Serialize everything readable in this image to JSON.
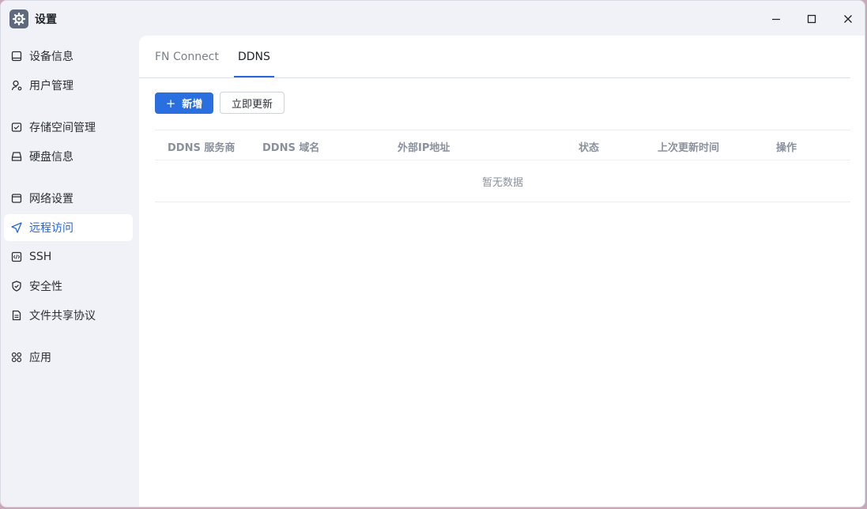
{
  "window": {
    "title": "设置",
    "app_icon": "gear-icon",
    "controls": [
      "minimize-icon",
      "maximize-icon",
      "close-icon"
    ]
  },
  "sidebar": {
    "items": [
      {
        "label": "设备信息",
        "icon": "device-icon"
      },
      {
        "label": "用户管理",
        "icon": "user-icon"
      },
      {
        "label": "存储空间管理",
        "icon": "storage-icon"
      },
      {
        "label": "硬盘信息",
        "icon": "disk-icon"
      },
      {
        "label": "网络设置",
        "icon": "network-icon"
      },
      {
        "label": "远程访问",
        "icon": "send-icon",
        "active": true
      },
      {
        "label": "SSH",
        "icon": "code-icon"
      },
      {
        "label": "安全性",
        "icon": "shield-icon"
      },
      {
        "label": "文件共享协议",
        "icon": "file-icon"
      },
      {
        "label": "应用",
        "icon": "apps-icon"
      }
    ]
  },
  "tabs": [
    {
      "label": "FN Connect"
    },
    {
      "label": "DDNS",
      "active": true
    }
  ],
  "toolbar": {
    "add_label": "新增",
    "update_label": "立即更新"
  },
  "table": {
    "columns": [
      "DDNS 服务商",
      "DDNS 域名",
      "外部IP地址",
      "状态",
      "上次更新时间",
      "操作"
    ],
    "empty_text": "暂无数据"
  },
  "colors": {
    "accent": "#2a66d9",
    "active_bg": "#ffffff",
    "sidebar_bg": "#f0f2f7"
  }
}
